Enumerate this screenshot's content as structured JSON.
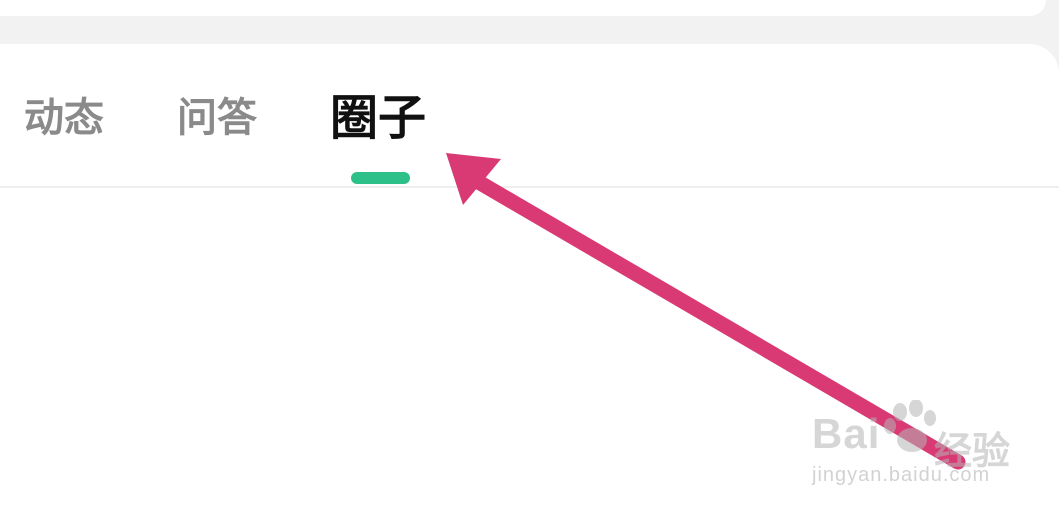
{
  "tabs": [
    {
      "label": "动态",
      "active": false
    },
    {
      "label": "问答",
      "active": false
    },
    {
      "label": "圈子",
      "active": true
    }
  ],
  "colors": {
    "active_indicator": "#2ec089",
    "annotation_arrow": "#d93a74",
    "inactive_tab_text": "#8a8a8a",
    "active_tab_text": "#111111"
  },
  "watermark": {
    "brand": "Bai",
    "brand_suffix": "经验",
    "url": "jingyan.baidu.com"
  }
}
